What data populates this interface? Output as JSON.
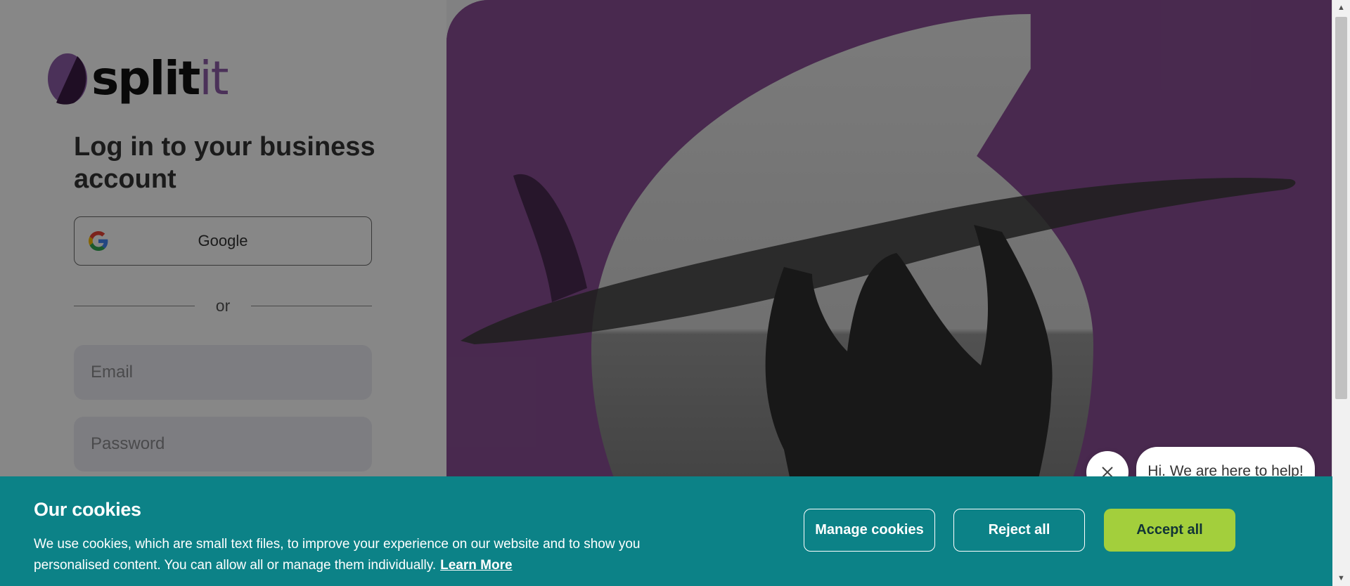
{
  "brand": {
    "name_main": "split",
    "name_accent": "it",
    "color_primary": "#8e5ea8",
    "color_hero": "#8a4f95"
  },
  "login": {
    "heading": "Log in to your business account",
    "google_label": "Google",
    "divider_text": "or",
    "email_placeholder": "Email",
    "password_placeholder": "Password"
  },
  "chat": {
    "bubble_text": "Hi. We are here to help!",
    "close_icon": "close-icon"
  },
  "cookie_banner": {
    "title": "Our cookies",
    "text": "We use cookies, which are small text files, to improve your experience on our website and to show you personalised content. You can allow all or manage them individually.",
    "learn_more": "Learn More",
    "manage_label": "Manage cookies",
    "reject_label": "Reject all",
    "accept_label": "Accept all",
    "background_color": "#0c8287",
    "accept_color": "#a3cf3c"
  }
}
